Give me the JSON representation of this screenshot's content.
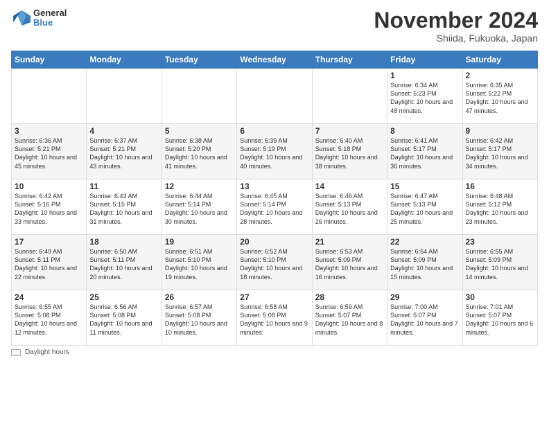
{
  "header": {
    "logo": {
      "general": "General",
      "blue": "Blue"
    },
    "title": "November 2024",
    "location": "Shiida, Fukuoka, Japan"
  },
  "weekdays": [
    "Sunday",
    "Monday",
    "Tuesday",
    "Wednesday",
    "Thursday",
    "Friday",
    "Saturday"
  ],
  "weeks": [
    [
      {
        "day": "",
        "info": ""
      },
      {
        "day": "",
        "info": ""
      },
      {
        "day": "",
        "info": ""
      },
      {
        "day": "",
        "info": ""
      },
      {
        "day": "",
        "info": ""
      },
      {
        "day": "1",
        "info": "Sunrise: 6:34 AM\nSunset: 5:23 PM\nDaylight: 10 hours and 48 minutes."
      },
      {
        "day": "2",
        "info": "Sunrise: 6:35 AM\nSunset: 5:22 PM\nDaylight: 10 hours and 47 minutes."
      }
    ],
    [
      {
        "day": "3",
        "info": "Sunrise: 6:36 AM\nSunset: 5:21 PM\nDaylight: 10 hours and 45 minutes."
      },
      {
        "day": "4",
        "info": "Sunrise: 6:37 AM\nSunset: 5:21 PM\nDaylight: 10 hours and 43 minutes."
      },
      {
        "day": "5",
        "info": "Sunrise: 6:38 AM\nSunset: 5:20 PM\nDaylight: 10 hours and 41 minutes."
      },
      {
        "day": "6",
        "info": "Sunrise: 6:39 AM\nSunset: 5:19 PM\nDaylight: 10 hours and 40 minutes."
      },
      {
        "day": "7",
        "info": "Sunrise: 6:40 AM\nSunset: 5:18 PM\nDaylight: 10 hours and 38 minutes."
      },
      {
        "day": "8",
        "info": "Sunrise: 6:41 AM\nSunset: 5:17 PM\nDaylight: 10 hours and 36 minutes."
      },
      {
        "day": "9",
        "info": "Sunrise: 6:42 AM\nSunset: 5:17 PM\nDaylight: 10 hours and 34 minutes."
      }
    ],
    [
      {
        "day": "10",
        "info": "Sunrise: 6:42 AM\nSunset: 5:16 PM\nDaylight: 10 hours and 33 minutes."
      },
      {
        "day": "11",
        "info": "Sunrise: 6:43 AM\nSunset: 5:15 PM\nDaylight: 10 hours and 31 minutes."
      },
      {
        "day": "12",
        "info": "Sunrise: 6:44 AM\nSunset: 5:14 PM\nDaylight: 10 hours and 30 minutes."
      },
      {
        "day": "13",
        "info": "Sunrise: 6:45 AM\nSunset: 5:14 PM\nDaylight: 10 hours and 28 minutes."
      },
      {
        "day": "14",
        "info": "Sunrise: 6:46 AM\nSunset: 5:13 PM\nDaylight: 10 hours and 26 minutes."
      },
      {
        "day": "15",
        "info": "Sunrise: 6:47 AM\nSunset: 5:13 PM\nDaylight: 10 hours and 25 minutes."
      },
      {
        "day": "16",
        "info": "Sunrise: 6:48 AM\nSunset: 5:12 PM\nDaylight: 10 hours and 23 minutes."
      }
    ],
    [
      {
        "day": "17",
        "info": "Sunrise: 6:49 AM\nSunset: 5:11 PM\nDaylight: 10 hours and 22 minutes."
      },
      {
        "day": "18",
        "info": "Sunrise: 6:50 AM\nSunset: 5:11 PM\nDaylight: 10 hours and 20 minutes."
      },
      {
        "day": "19",
        "info": "Sunrise: 6:51 AM\nSunset: 5:10 PM\nDaylight: 10 hours and 19 minutes."
      },
      {
        "day": "20",
        "info": "Sunrise: 6:52 AM\nSunset: 5:10 PM\nDaylight: 10 hours and 18 minutes."
      },
      {
        "day": "21",
        "info": "Sunrise: 6:53 AM\nSunset: 5:09 PM\nDaylight: 10 hours and 16 minutes."
      },
      {
        "day": "22",
        "info": "Sunrise: 6:54 AM\nSunset: 5:09 PM\nDaylight: 10 hours and 15 minutes."
      },
      {
        "day": "23",
        "info": "Sunrise: 6:55 AM\nSunset: 5:09 PM\nDaylight: 10 hours and 14 minutes."
      }
    ],
    [
      {
        "day": "24",
        "info": "Sunrise: 6:55 AM\nSunset: 5:08 PM\nDaylight: 10 hours and 12 minutes."
      },
      {
        "day": "25",
        "info": "Sunrise: 6:56 AM\nSunset: 5:08 PM\nDaylight: 10 hours and 11 minutes."
      },
      {
        "day": "26",
        "info": "Sunrise: 6:57 AM\nSunset: 5:08 PM\nDaylight: 10 hours and 10 minutes."
      },
      {
        "day": "27",
        "info": "Sunrise: 6:58 AM\nSunset: 5:08 PM\nDaylight: 10 hours and 9 minutes."
      },
      {
        "day": "28",
        "info": "Sunrise: 6:59 AM\nSunset: 5:07 PM\nDaylight: 10 hours and 8 minutes."
      },
      {
        "day": "29",
        "info": "Sunrise: 7:00 AM\nSunset: 5:07 PM\nDaylight: 10 hours and 7 minutes."
      },
      {
        "day": "30",
        "info": "Sunrise: 7:01 AM\nSunset: 5:07 PM\nDaylight: 10 hours and 6 minutes."
      }
    ]
  ],
  "legend": {
    "daylight_label": "Daylight hours"
  }
}
